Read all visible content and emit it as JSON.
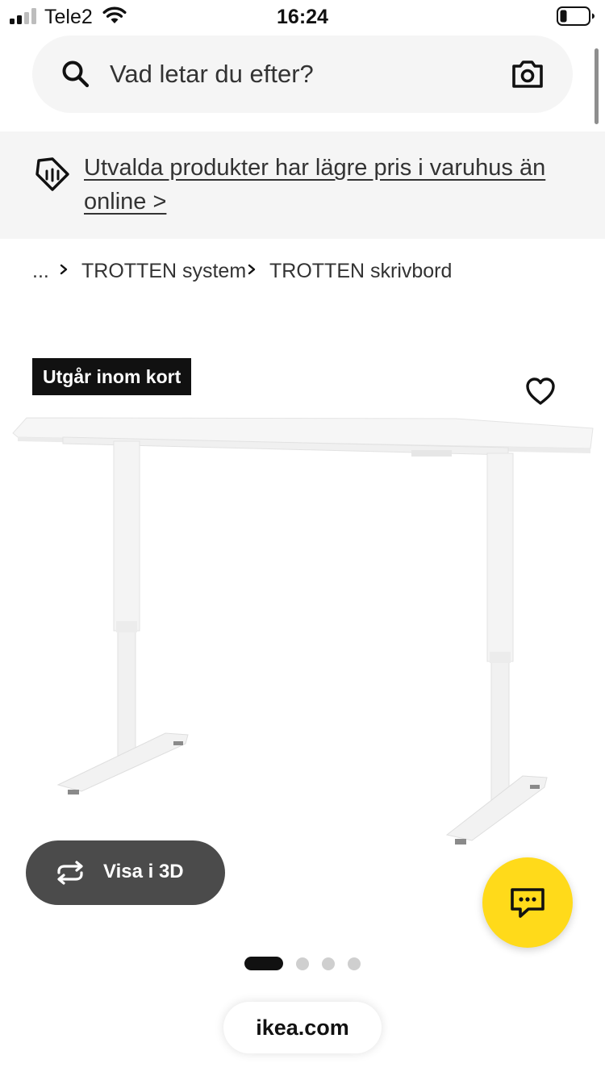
{
  "status_bar": {
    "carrier": "Tele2",
    "time": "16:24"
  },
  "search": {
    "placeholder": "Vad letar du efter?",
    "icon": "search-icon",
    "camera_icon": "camera-icon"
  },
  "promo": {
    "icon": "price-tag-icon",
    "text": "Utvalda produkter har lägre pris i varuhus än online >"
  },
  "breadcrumb": {
    "items": [
      "...",
      "TROTTEN system",
      "TROTTEN skrivbord"
    ]
  },
  "product": {
    "badge": "Utgår inom kort",
    "favorite_icon": "heart-icon",
    "image_alt": "white-sit-stand-desk"
  },
  "view_3d": {
    "label": "Visa i 3D",
    "icon": "rotate-icon"
  },
  "chat": {
    "icon": "chat-icon"
  },
  "carousel": {
    "slide_count": 4,
    "active_index": 0
  },
  "browser": {
    "url": "ikea.com"
  },
  "colors": {
    "accent_yellow": "#ffda1a",
    "badge_black": "#111111",
    "surface_grey": "#f5f5f5"
  }
}
